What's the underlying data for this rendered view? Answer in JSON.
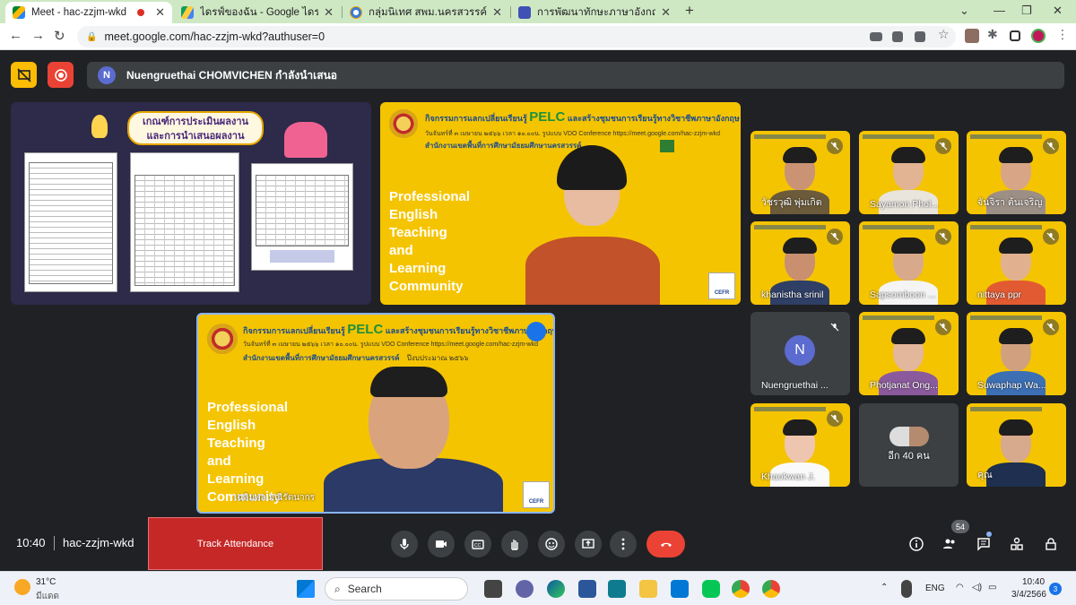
{
  "browser": {
    "tabs": [
      {
        "title": "Meet - hac-zzjm-wkd",
        "active": true,
        "recording": true
      },
      {
        "title": "ไดรฟ์ของฉัน - Google ไดรฟ์",
        "active": false
      },
      {
        "title": "กลุ่มนิเทศ สพม.นครสวรรค์",
        "active": false
      },
      {
        "title": "การพัฒนาทักษะภาษาอังกฤษ English",
        "active": false
      }
    ],
    "new_tab_label": "+",
    "address": "meet.google.com/hac-zzjm-wkd?authuser=0"
  },
  "meet": {
    "presenter_initial": "N",
    "presenter_banner": "Nuengruethai CHOMVICHEN กำลังนำเสนอ",
    "shared_slide": {
      "title_line1": "เกณฑ์การประเมินผลงาน",
      "title_line2": "และการนำเสนอผลงาน"
    },
    "banner": {
      "heading": "กิจกรรมการแลกเปลี่ยนเรียนรู้",
      "pelc": "PELC",
      "heading_tail": "และสร้างชุมชนการเรียนรู้ทางวิชาชีพภาษาอังกฤษ",
      "date_line": "วันจันทร์ที่ ๓ เมษายน ๒๕๖๖ เวลา ๑๐.๐๐น. รูปแบบ VDO Conference https://meet.google.com/hac-zzjm-wkd",
      "office": "สำนักงานเขตพื้นที่การศึกษามัธยมศึกษานครสวรรค์",
      "year": "ปีงบประมาณ ๒๕๖๖",
      "big": "Professional\nEnglish\nTeaching\nand\nLearning\nCommunity",
      "cefr": "CEFR"
    },
    "main_speaker_name": "เฉลิมพล มณีรัตนากร",
    "participants": [
      {
        "name": "วัชรวุฒิ พุ่มเกิด"
      },
      {
        "name": "Sayamon Phol..."
      },
      {
        "name": "จันจิรา ต้นเจริญ"
      },
      {
        "name": "khanistha srinil"
      },
      {
        "name": "Sapsomboon ..."
      },
      {
        "name": "nittaya ppr"
      },
      {
        "name": "Nuengruethai ...",
        "initial": "N"
      },
      {
        "name": "Photjanat Ong..."
      },
      {
        "name": "Suwaphap Wa..."
      },
      {
        "name": "Khaokwan J."
      },
      {
        "name": "อีก 40 คน"
      },
      {
        "name": "คุณ"
      }
    ],
    "time": "10:40",
    "meeting_code": "hac-zzjm-wkd",
    "track_button": "Track Attendance",
    "participant_count": "54"
  },
  "taskbar": {
    "weather_temp": "31°C",
    "weather_desc": "มีแดด",
    "search_label": "Search",
    "lang": "ENG",
    "clock_time": "10:40",
    "clock_date": "3/4/2566",
    "notif_count": "3"
  },
  "colors": {
    "accent": "#f5c400",
    "end_call": "#ea4335",
    "track_btn": "#c62828",
    "tab_bar": "#cfe8c4"
  }
}
